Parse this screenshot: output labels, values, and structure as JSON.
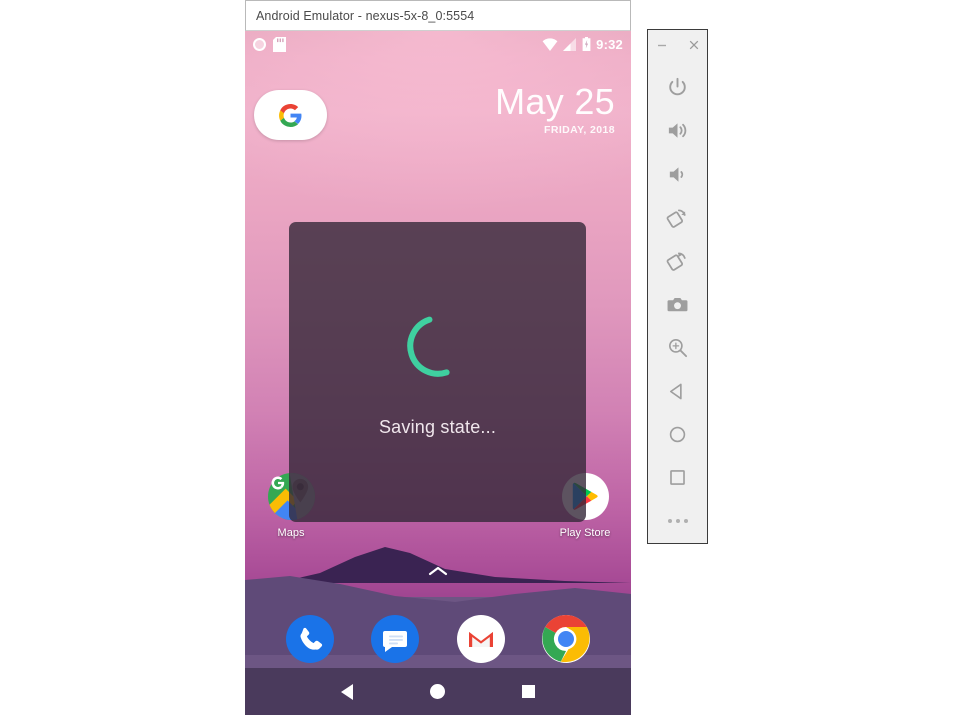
{
  "window": {
    "title": "Android Emulator - nexus-5x-8_0:5554"
  },
  "status_bar": {
    "left_icons": [
      "screen-record-icon",
      "sd-card-icon"
    ],
    "right_icons": [
      "wifi-icon",
      "cellular-signal-icon",
      "battery-charging-icon"
    ],
    "time": "9:32"
  },
  "home": {
    "search_widget": {
      "icon": "google-g-icon"
    },
    "date": {
      "main": "May 25",
      "sub": "FRIDAY, 2018"
    },
    "all_apps_icon": "chevron-up-icon",
    "apps": [
      {
        "name": "maps",
        "label": "Maps",
        "icon": "google-maps-icon"
      },
      {
        "name": "play-store",
        "label": "Play Store",
        "icon": "google-play-icon"
      }
    ],
    "dock": [
      {
        "name": "phone",
        "label": "Phone",
        "icon": "phone-icon"
      },
      {
        "name": "messages",
        "label": "Messages",
        "icon": "messages-icon"
      },
      {
        "name": "gmail",
        "label": "Gmail",
        "icon": "gmail-icon"
      },
      {
        "name": "chrome",
        "label": "Chrome",
        "icon": "chrome-icon"
      }
    ],
    "navbar": [
      {
        "name": "back",
        "label": "Back",
        "icon": "back-triangle-icon"
      },
      {
        "name": "home",
        "label": "Home",
        "icon": "home-circle-icon"
      },
      {
        "name": "recents",
        "label": "Recents",
        "icon": "recents-square-icon"
      }
    ]
  },
  "dialog": {
    "text": "Saving state...",
    "spinner_color": "#3fd0a0",
    "background": "rgba(52,40,56,0.80)"
  },
  "toolbar": {
    "window_buttons": [
      {
        "name": "minimize",
        "glyph": "−"
      },
      {
        "name": "close",
        "glyph": "×"
      }
    ],
    "buttons": [
      {
        "name": "power",
        "icon": "power-icon",
        "label": "Power"
      },
      {
        "name": "volume-up",
        "icon": "volume-up-icon",
        "label": "Volume Up"
      },
      {
        "name": "volume-down",
        "icon": "volume-down-icon",
        "label": "Volume Down"
      },
      {
        "name": "rotate-left",
        "icon": "rotate-left-icon",
        "label": "Rotate Left"
      },
      {
        "name": "rotate-right",
        "icon": "rotate-right-icon",
        "label": "Rotate Right"
      },
      {
        "name": "screenshot",
        "icon": "camera-icon",
        "label": "Take Screenshot"
      },
      {
        "name": "zoom",
        "icon": "zoom-in-icon",
        "label": "Enter Zoom Mode"
      },
      {
        "name": "back",
        "icon": "back-triangle-icon",
        "label": "Back"
      },
      {
        "name": "home",
        "icon": "home-circle-icon",
        "label": "Home"
      },
      {
        "name": "overview",
        "icon": "recents-square-icon",
        "label": "Overview"
      },
      {
        "name": "more",
        "icon": "more-dots-icon",
        "label": "More"
      }
    ]
  },
  "colors": {
    "wallpaper_top": "#eeb0c9",
    "wallpaper_bottom": "#58296a",
    "navbar": "#4a3a5c",
    "accent_teal": "#3fd0a0",
    "toolbar_bg": "#f0f0f0"
  }
}
